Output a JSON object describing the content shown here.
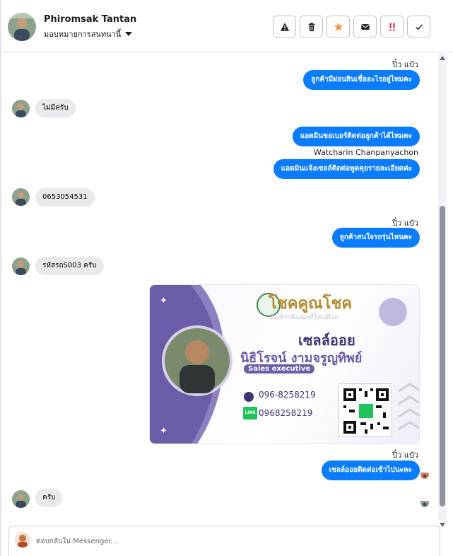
{
  "header": {
    "contact_name": "Phiromsak Tantan",
    "assign_label": "มอบหมายการสนทนานี้",
    "actions": [
      {
        "icon": "warning-icon"
      },
      {
        "icon": "trash-icon"
      },
      {
        "icon": "star-icon",
        "color": "#f7923b"
      },
      {
        "icon": "mail-icon"
      },
      {
        "icon": "priority-icon",
        "color": "#e41e3f"
      },
      {
        "icon": "check-icon"
      }
    ]
  },
  "messages": [
    {
      "dir": "meta",
      "text": "ปิ๋ว แป๋ว"
    },
    {
      "dir": "out",
      "text": "ลูกค้ามีผ่อนสินเชื่ออะไรอยู่ไหมคะ"
    },
    {
      "dir": "in",
      "text": "ไม่มีครับ"
    },
    {
      "dir": "out",
      "text": "แอดมินขอเบอร์ติดต่อลูกค้าได้ไหมคะ"
    },
    {
      "dir": "meta",
      "text": "Watcharin Chanpanyachon"
    },
    {
      "dir": "out",
      "text": "แอดมินแจ้งเซลล์ติดต่อพูดคุยรายละเอียดค่ะ"
    },
    {
      "dir": "in",
      "text": "0653054531"
    },
    {
      "dir": "meta",
      "text": "ปิ๋ว แป๋ว"
    },
    {
      "dir": "out",
      "text": "ลูกค้าสนใจรถรุ่นไหนคะ"
    },
    {
      "dir": "in",
      "text": "รหัสรถS003 ครับ"
    },
    {
      "dir": "image",
      "card": {
        "brand": "โชคคูณโชค",
        "tagline": "เต็นท์รถมือสองที่ใหญ่ที่สุด",
        "title": "เซลล์ออย",
        "person": "นิธิโรจน์  งามจรูญทิพย์",
        "role": "Sales executive",
        "phone": "096-8258219",
        "line_label": "LINE",
        "line": "0968258219"
      }
    },
    {
      "dir": "meta",
      "text": "ปิ๋ว แป๋ว"
    },
    {
      "dir": "out",
      "text": "เซลล์ออยติดต่อเข้าไปนะคะ"
    },
    {
      "dir": "in",
      "text": "ครับ"
    }
  ],
  "composer": {
    "placeholder": "ตอบกลับใน Messenger..."
  }
}
